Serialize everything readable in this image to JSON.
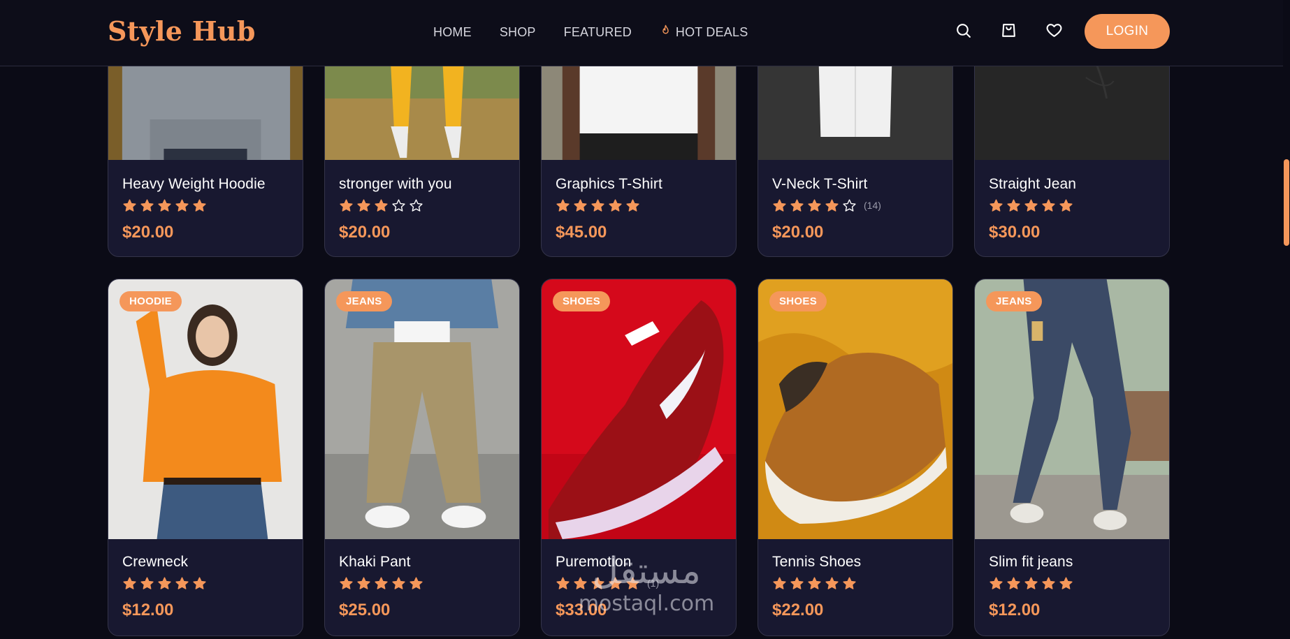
{
  "navbar": {
    "logo": "Style Hub",
    "links": [
      {
        "label": "HOME"
      },
      {
        "label": "SHOP"
      },
      {
        "label": "FEATURED"
      },
      {
        "label": "HOT DEALS",
        "icon": "fire-icon"
      }
    ],
    "icons": [
      "search-icon",
      "shopping-bag-icon",
      "heart-icon"
    ],
    "login_label": "LOGIN"
  },
  "colors": {
    "accent": "#f5975a",
    "background": "#0b0b16",
    "card_background": "#181830",
    "nav_text": "#d6d6de"
  },
  "products": [
    {
      "name": "Heavy Weight Hoodie",
      "price": "$20.00",
      "rating": 5,
      "reviews": ""
    },
    {
      "name": "stronger with you",
      "price": "$20.00",
      "rating": 3,
      "reviews": ""
    },
    {
      "name": "Graphics T-Shirt",
      "price": "$45.00",
      "rating": 5,
      "reviews": ""
    },
    {
      "name": "V-Neck T-Shirt",
      "price": "$20.00",
      "rating": 4,
      "reviews": "(14)"
    },
    {
      "name": "Straight Jean",
      "price": "$30.00",
      "rating": 5,
      "reviews": ""
    },
    {
      "name": "Crewneck",
      "category": "HOODIE",
      "price": "$12.00",
      "rating": 5,
      "reviews": ""
    },
    {
      "name": "Khaki Pant",
      "category": "JEANS",
      "price": "$25.00",
      "rating": 5,
      "reviews": ""
    },
    {
      "name": "Puremotion",
      "category": "SHOES",
      "price": "$33.00",
      "rating": 5,
      "reviews": "(1)"
    },
    {
      "name": "Tennis Shoes",
      "category": "SHOES",
      "price": "$22.00",
      "rating": 5,
      "reviews": ""
    },
    {
      "name": "Slim fit jeans",
      "category": "JEANS",
      "price": "$12.00",
      "rating": 5,
      "reviews": ""
    }
  ],
  "watermark": {
    "arabic": "مستقل",
    "latin": "mostaql.com"
  }
}
